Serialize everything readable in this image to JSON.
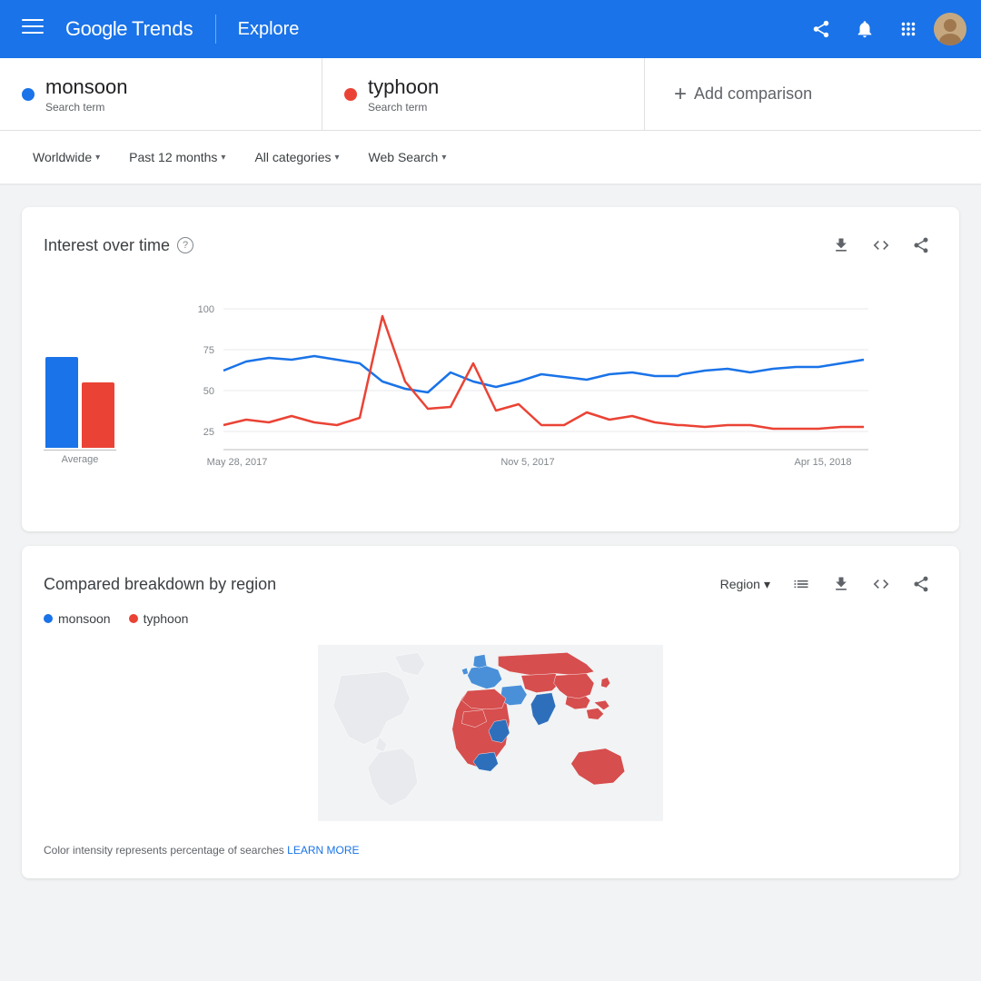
{
  "header": {
    "menu_icon": "☰",
    "logo": "Google Trends",
    "explore_label": "Explore",
    "share_icon": "share",
    "notifications_icon": "notifications",
    "apps_icon": "apps",
    "account_icon": "account"
  },
  "search_terms": [
    {
      "id": "monsoon",
      "name": "monsoon",
      "type": "Search term",
      "color": "#1a73e8"
    },
    {
      "id": "typhoon",
      "name": "typhoon",
      "type": "Search term",
      "color": "#ea4335"
    }
  ],
  "add_comparison_label": "Add comparison",
  "filters": {
    "region": {
      "label": "Worldwide"
    },
    "time": {
      "label": "Past 12 months"
    },
    "category": {
      "label": "All categories"
    },
    "search_type": {
      "label": "Web Search"
    }
  },
  "interest_over_time": {
    "title": "Interest over time",
    "help": "?",
    "y_labels": [
      "100",
      "75",
      "50",
      "25"
    ],
    "x_labels": [
      "May 28, 2017",
      "Nov 5, 2017",
      "Apr 15, 2018"
    ],
    "avg_label": "Average",
    "bar_blue_height": 80,
    "bar_red_height": 58
  },
  "region_breakdown": {
    "title": "Compared breakdown by region",
    "region_label": "Region",
    "legend": [
      {
        "term": "monsoon",
        "color": "#1a73e8"
      },
      {
        "term": "typhoon",
        "color": "#ea4335"
      }
    ],
    "color_note": "Color intensity represents percentage of searches",
    "learn_more": "LEARN MORE"
  },
  "icons": {
    "download": "↓",
    "embed": "<>",
    "share": "⎋",
    "list": "≡",
    "dropdown_arrow": "▾"
  }
}
